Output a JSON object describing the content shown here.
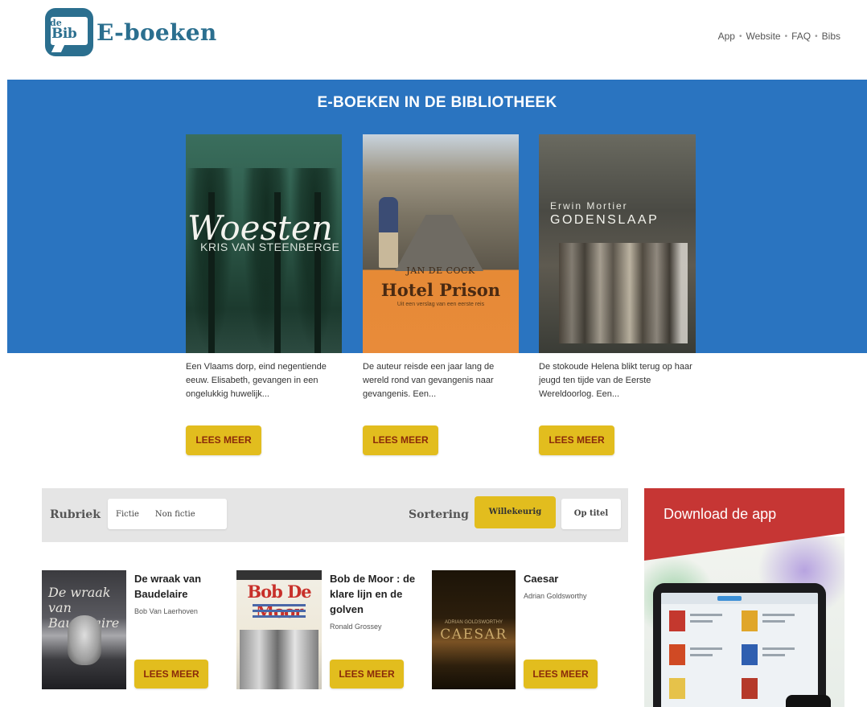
{
  "header": {
    "logo_top": "de",
    "logo_mid": "Bib",
    "logo_text": "E-boeken",
    "nav": [
      "App",
      "Website",
      "FAQ",
      "Bibs"
    ],
    "nav_separator": "•"
  },
  "hero": {
    "title": "E-BOEKEN IN DE BIBLIOTHEEK",
    "books": [
      {
        "cover_title": "Woesten",
        "cover_author": "KRIS VAN STEENBERGE",
        "blurb": "Een Vlaams dorp, eind negentiende eeuw. Elisabeth, gevangen in een ongelukkig huwelijk...",
        "button": "LEES MEER"
      },
      {
        "cover_author": "JAN DE COCK",
        "cover_title": "Hotel Prison",
        "cover_subtitle": "Uit een verslag van een eerste reis",
        "blurb": "De auteur reisde een jaar lang de wereld rond van gevangenis naar gevangenis. Een...",
        "button": "LEES MEER"
      },
      {
        "cover_author": "Erwin Mortier",
        "cover_title": "GODENSLAAP",
        "blurb": "De stokoude Helena blikt terug op haar jeugd ten tijde van de Eerste Wereldoorlog. Een...",
        "button": "LEES MEER"
      }
    ]
  },
  "filters": {
    "rubriek_label": "Rubriek",
    "rubriek_options": [
      "Fictie",
      "Non fictie"
    ],
    "sort_label": "Sortering",
    "sort_options": [
      "Willekeurig",
      "Op titel"
    ],
    "sort_selected": "Willekeurig"
  },
  "books": [
    {
      "cover_title": "De wraak van Baudelaire",
      "title": "De wraak van Baudelaire",
      "author": "Bob Van Laerhoven",
      "button": "LEES MEER"
    },
    {
      "cover_title": "Bob De Moor",
      "title": "Bob de Moor : de klare lijn en de golven",
      "author": "Ronald Grossey",
      "button": "LEES MEER"
    },
    {
      "cover_author": "ADRIAN GOLDSWORTHY",
      "cover_title": "CAESAR",
      "title": "Caesar",
      "author": "Adrian Goldsworthy",
      "button": "LEES MEER"
    }
  ],
  "promo": {
    "title": "Download de app"
  },
  "colors": {
    "brand_blue": "#2a74c0",
    "logo_blue": "#2b6f8f",
    "button_yellow": "#e2bd1e",
    "promo_red": "#c63634"
  }
}
